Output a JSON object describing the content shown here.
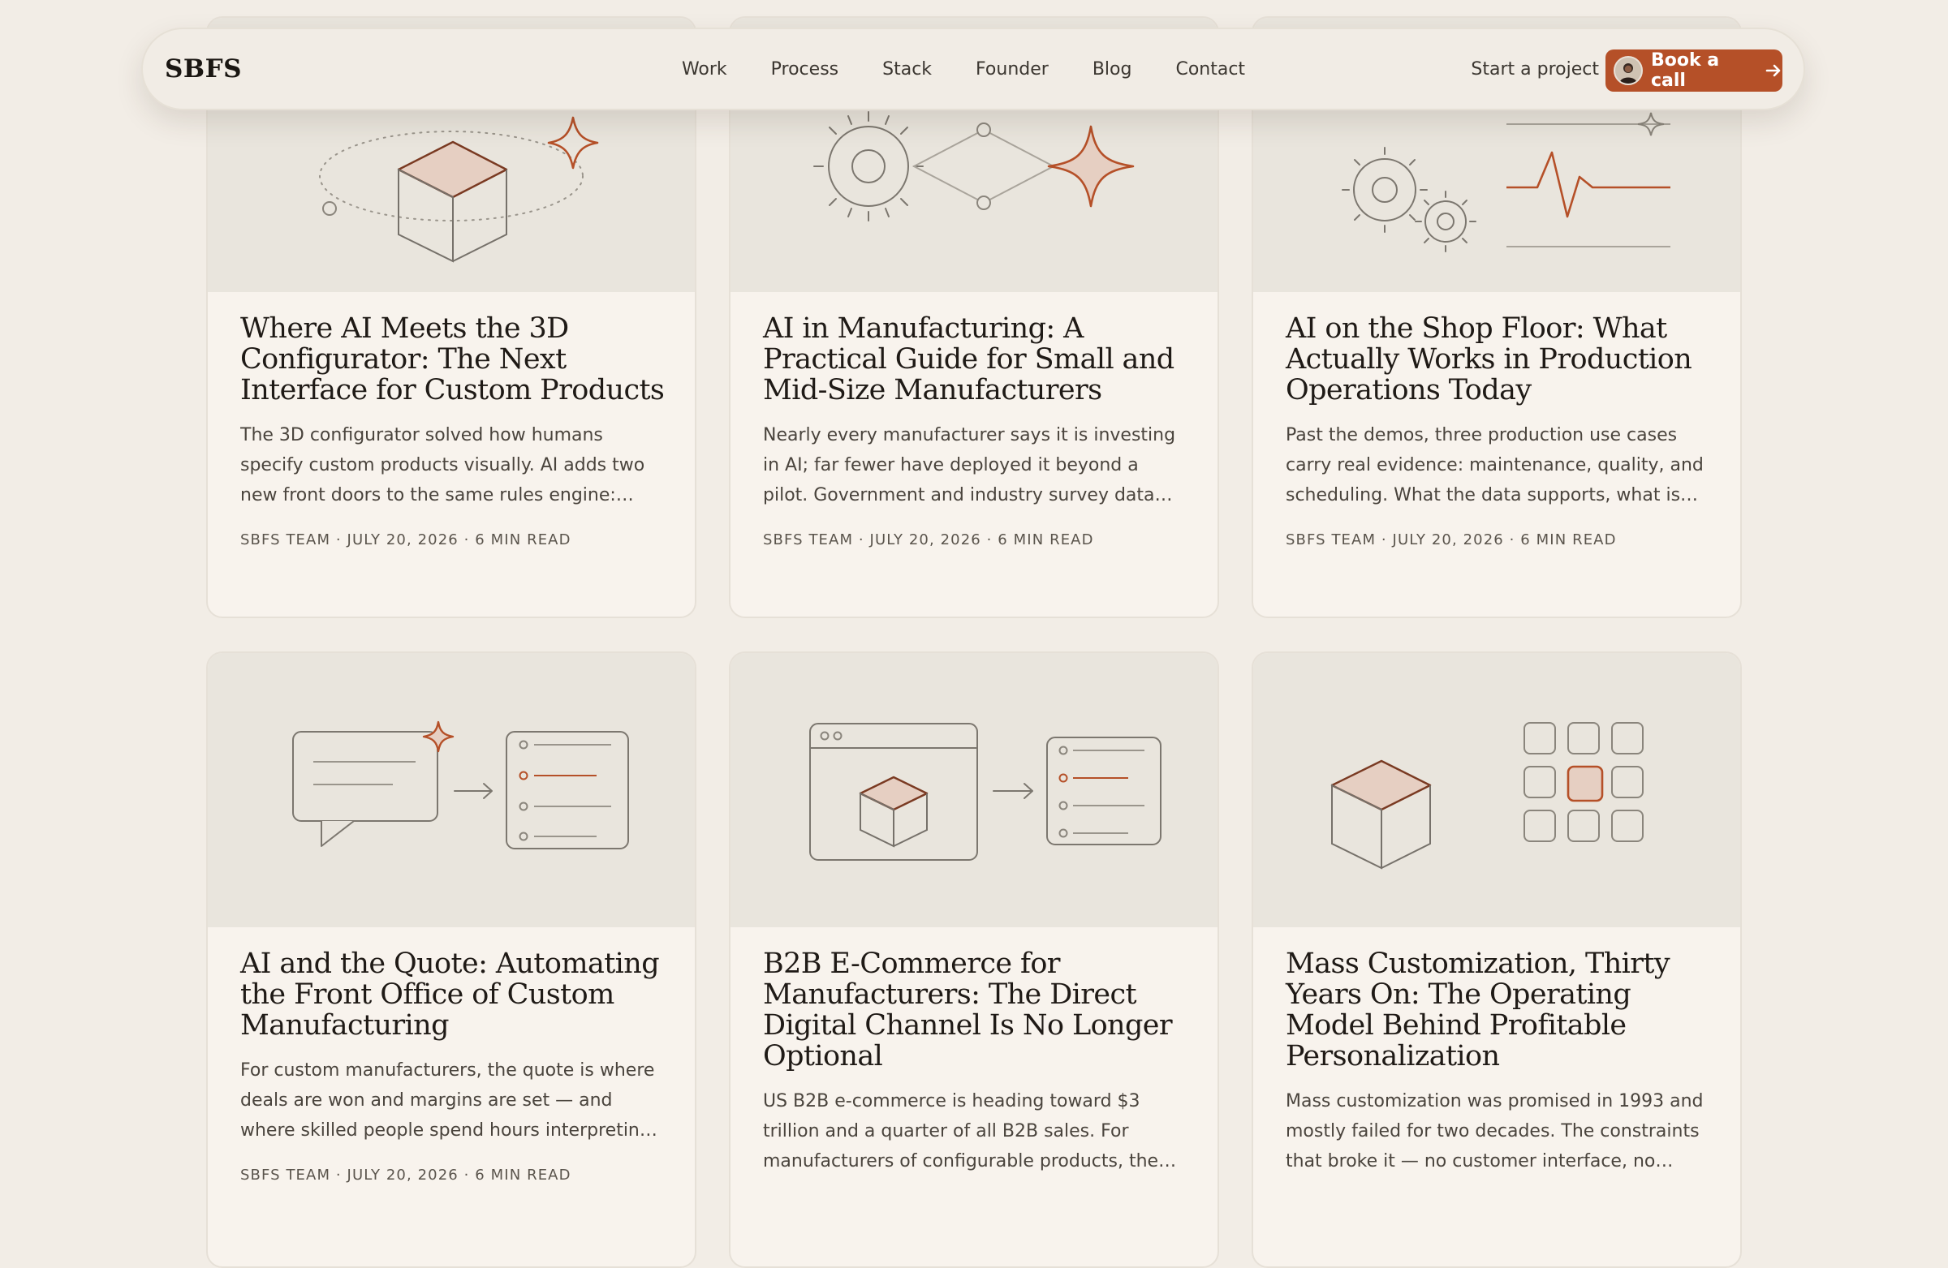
{
  "nav": {
    "brand": "SBFS",
    "links": [
      "Work",
      "Process",
      "Stack",
      "Founder",
      "Blog",
      "Contact"
    ],
    "start_project": "Start a project",
    "book_call": "Book a call"
  },
  "colors": {
    "accent": "#b55028",
    "background": "#f2ede6",
    "card_bg": "#f8f3ed",
    "illustration_bg": "#e9e5dd"
  },
  "posts": [
    {
      "title": "Where AI Meets the 3D Configurator: The Next Interface for Custom Products",
      "excerpt": "The 3D configurator solved how humans specify custom products visually. AI adds two new front doors to the same rules engine: natural language...",
      "meta": "SBFS TEAM · JULY 20, 2026 · 6 MIN READ",
      "illustration": "cube-orbit-sparkle"
    },
    {
      "title": "AI in Manufacturing: A Practical Guide for Small and Mid-Size Manufacturers",
      "excerpt": "Nearly every manufacturer says it is investing in AI; far fewer have deployed it beyond a pilot. Government and industry survey data show where...",
      "meta": "SBFS TEAM · JULY 20, 2026 · 6 MIN READ",
      "illustration": "gear-network-sparkle"
    },
    {
      "title": "AI on the Shop Floor: What Actually Works in Production Operations Today",
      "excerpt": "Past the demos, three production use cases carry real evidence: maintenance, quality, and scheduling. What the data supports, what is still...",
      "meta": "SBFS TEAM · JULY 20, 2026 · 6 MIN READ",
      "illustration": "gears-signal"
    },
    {
      "title": "AI and the Quote: Automating the Front Office of Custom Manufacturing",
      "excerpt": "For custom manufacturers, the quote is where deals are won and margins are set — and where skilled people spend hours interpreting emails,...",
      "meta": "SBFS TEAM · JULY 20, 2026 · 6 MIN READ",
      "illustration": "chat-to-list"
    },
    {
      "title": "B2B E-Commerce for Manufacturers: The Direct Digital Channel Is No Longer Optional",
      "excerpt": "US B2B e-commerce is heading toward $3 trillion and a quarter of all B2B sales. For manufacturers of configurable products, the question has shifted...",
      "meta": "",
      "illustration": "browser-to-list"
    },
    {
      "title": "Mass Customization, Thirty Years On: The Operating Model Behind Profitable Personalization",
      "excerpt": "Mass customization was promised in 1993 and mostly failed for two decades. The constraints that broke it — no customer interface, no capture...",
      "meta": "",
      "illustration": "cube-grid"
    }
  ]
}
